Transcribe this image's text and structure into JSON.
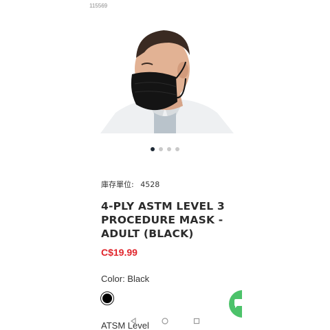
{
  "status": {
    "id_text": "115569"
  },
  "product": {
    "image_alt": "Man wearing black procedure mask",
    "carousel": {
      "count": 4,
      "active_index": 0
    },
    "sku_label": "庫存單位:",
    "sku_value": "4528",
    "title": "4-PLY ASTM LEVEL 3 PROCEDURE MASK - ADULT (BLACK)",
    "price": "C$19.99",
    "color_label": "Color: Black",
    "swatch_color": "#000000",
    "next_attribute_label": "ATSM Level"
  },
  "colors": {
    "price": "#e0242b",
    "fab": "#4cc26a",
    "dot_active": "#1f2a36",
    "dot_inactive": "#c9c9c9"
  },
  "icons": {
    "nav_back": "triangle-back-icon",
    "nav_home": "circle-home-icon",
    "nav_recents": "square-recents-icon",
    "chat": "chat-bubble-icon"
  }
}
